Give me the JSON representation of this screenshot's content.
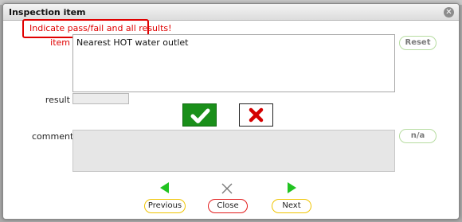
{
  "dialog": {
    "title": "Inspection item",
    "close_icon": "close-circle-icon"
  },
  "warning": {
    "text": "Indicate pass/fail and all results!",
    "color": "#e00000"
  },
  "form": {
    "item_label": "item",
    "item_value": "Nearest HOT water outlet",
    "result_label": "result",
    "result_value": "",
    "comment_label": "comment",
    "comment_value": ""
  },
  "buttons": {
    "reset_label": "Reset",
    "na_label": "n/a",
    "pass_icon": "checkmark-icon",
    "fail_icon": "x-icon",
    "pass_color": "#1a8f1a",
    "fail_color": "#d40000"
  },
  "nav": {
    "previous_label": "Previous",
    "close_label": "Close",
    "next_label": "Next",
    "arrow_color": "#21c321"
  }
}
